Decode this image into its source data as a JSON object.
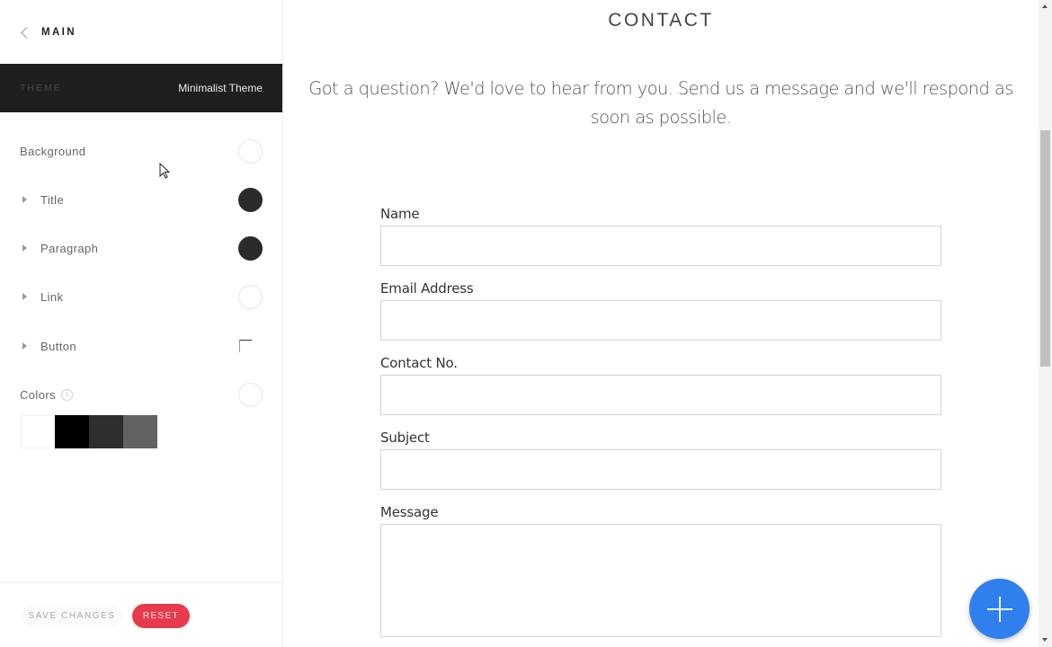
{
  "sidebar": {
    "back_label": "MAIN",
    "theme": {
      "key": "THEME",
      "value": "Minimalist Theme"
    },
    "items": [
      {
        "label": "Background",
        "expandable": false,
        "swatch": "#ffffff"
      },
      {
        "label": "Title",
        "expandable": true,
        "swatch": "#2b2b2b"
      },
      {
        "label": "Paragraph",
        "expandable": true,
        "swatch": "#2b2b2b"
      },
      {
        "label": "Link",
        "expandable": true,
        "swatch": "#ffffff"
      },
      {
        "label": "Button",
        "expandable": true,
        "swatch": "corner-style"
      },
      {
        "label": "Colors",
        "expandable": false,
        "swatch": "#ffffff",
        "info_icon": "i"
      }
    ],
    "palette": [
      "#ffffff",
      "#000000",
      "#2e2e2e",
      "#626262"
    ],
    "save_label": "SAVE CHANGES",
    "reset_label": "RESET"
  },
  "main": {
    "title": "CONTACT",
    "intro": "Got a question? We'd love to hear from you. Send us a message and we'll respond as soon as possible.",
    "form": {
      "fields": [
        {
          "label": "Name",
          "value": "",
          "placeholder": ""
        },
        {
          "label": "Email Address",
          "value": "",
          "placeholder": ""
        },
        {
          "label": "Contact No.",
          "value": "",
          "placeholder": ""
        },
        {
          "label": "Subject",
          "value": "",
          "placeholder": ""
        },
        {
          "label": "Message",
          "value": "",
          "placeholder": ""
        }
      ]
    },
    "fab_icon": "plus-icon"
  },
  "colors": {
    "accent_blue": "#2f80ed",
    "reset_red": "#e73a4d",
    "theme_bar": "#1f1f1f"
  }
}
